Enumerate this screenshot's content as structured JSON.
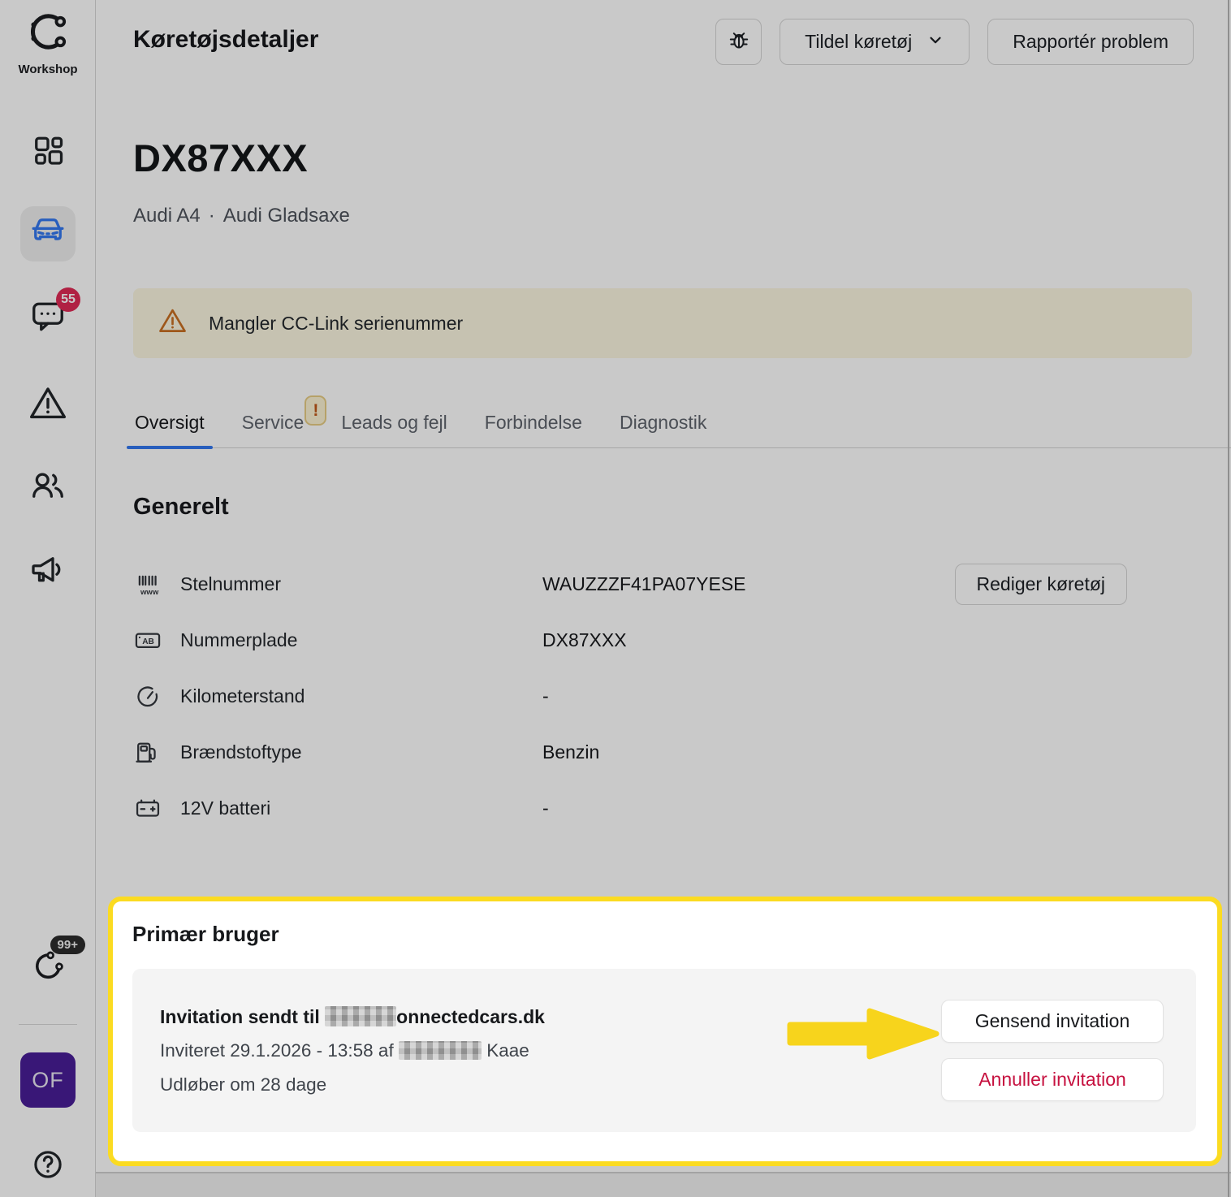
{
  "sidebar": {
    "brand_label": "Workshop",
    "messages_badge": "55",
    "updates_badge": "99+",
    "avatar_initials": "OF",
    "help_glyph": "?"
  },
  "header": {
    "title": "Køretøjsdetaljer",
    "assign_button_label": "Tildel køretøj",
    "report_button_label": "Rapportér problem"
  },
  "vehicle": {
    "plate_title": "DX87XXX",
    "model": "Audi A4",
    "separator": "·",
    "dealer": "Audi Gladsaxe"
  },
  "banner": {
    "text": "Mangler CC-Link serienummer"
  },
  "tabs": {
    "items": [
      {
        "label": "Oversigt"
      },
      {
        "label": "Service",
        "badge": "!"
      },
      {
        "label": "Leads og fejl"
      },
      {
        "label": "Forbindelse"
      },
      {
        "label": "Diagnostik"
      }
    ]
  },
  "general": {
    "heading": "Generelt",
    "edit_button_label": "Rediger køretøj",
    "rows": [
      {
        "label": "Stelnummer",
        "value": "WAUZZZF41PA07YESE"
      },
      {
        "label": "Nummerplade",
        "value": "DX87XXX"
      },
      {
        "label": "Kilometerstand",
        "value": "-"
      },
      {
        "label": "Brændstoftype",
        "value": "Benzin"
      },
      {
        "label": "12V batteri",
        "value": "-"
      }
    ]
  },
  "primary_user": {
    "heading": "Primær bruger",
    "invitation_prefix": "Invitation sendt til ",
    "email_visible": "onnectedcars.dk",
    "invited_prefix": "Inviteret 29.1.2026 - 13:58 af ",
    "invited_suffix": " Kaae",
    "expires_text": "Udløber om 28 dage",
    "resend_button_label": "Gensend invitation",
    "cancel_button_label": "Annuller invitation"
  },
  "icon_glyphs": {
    "vin_sub": "www",
    "plate_letters": "AB"
  },
  "colors": {
    "accent_blue": "#3378f0",
    "highlight_yellow": "#fbdb21",
    "arrow_yellow": "#f7d41c",
    "danger_red": "#c6113f",
    "badge_red": "#e02a55",
    "avatar_purple": "#491e97",
    "banner_bg": "#fbf7e1",
    "warning_orange": "#c96f22"
  }
}
